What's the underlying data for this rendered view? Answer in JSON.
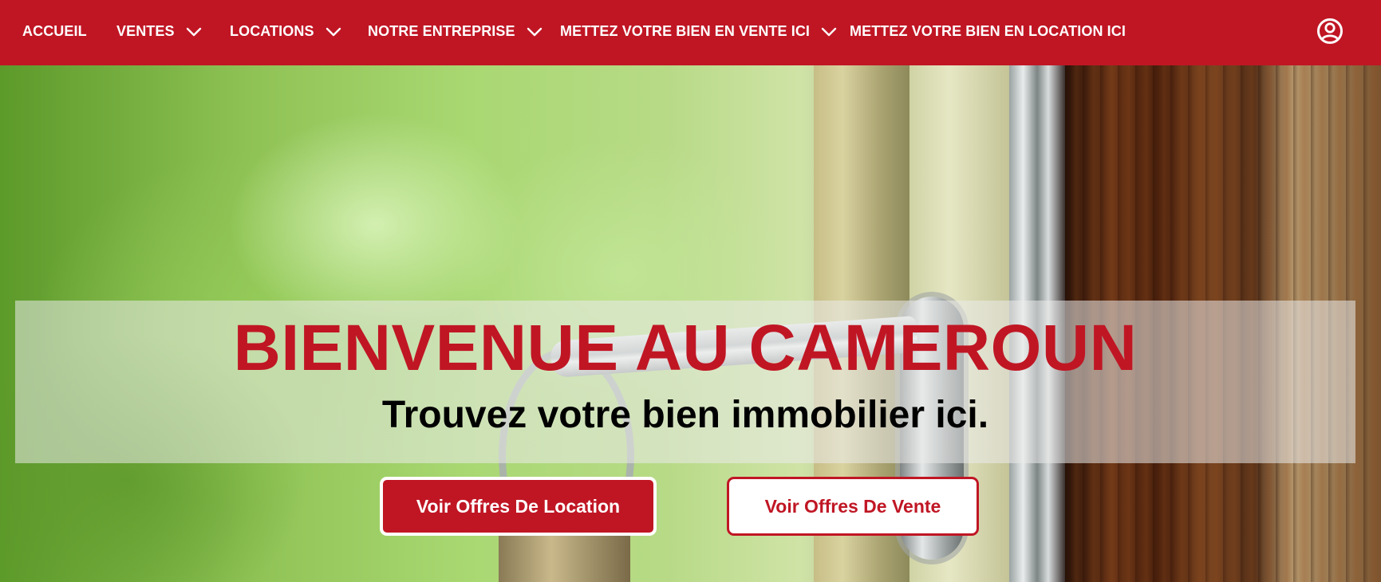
{
  "brand": {
    "primary": "#c01624",
    "text_light": "#ffffff",
    "text_dark": "#000000"
  },
  "nav": {
    "items": [
      {
        "label": "ACCUEIL",
        "has_dropdown": false,
        "icon": ""
      },
      {
        "label": "VENTES",
        "has_dropdown": true,
        "icon": "chevron-down-icon"
      },
      {
        "label": "LOCATIONS",
        "has_dropdown": true,
        "icon": "chevron-down-icon"
      },
      {
        "label": "NOTRE ENTREPRISE",
        "has_dropdown": true,
        "icon": "chevron-down-icon"
      },
      {
        "label": "METTEZ VOTRE BIEN EN VENTE ICI",
        "has_dropdown": true,
        "icon": "chevron-down-icon"
      },
      {
        "label": "METTEZ VOTRE BIEN EN LOCATION ICI",
        "has_dropdown": false,
        "icon": ""
      }
    ],
    "account_icon": "user-account-icon"
  },
  "hero": {
    "title": "BIENVENUE AU CAMEROUN",
    "subtitle": "Trouvez votre bien immobilier ici.",
    "background_icon": "key-in-door-lock-photo",
    "buttons": {
      "location_label": "Voir Offres De Location",
      "vente_label": "Voir Offres De Vente"
    }
  }
}
